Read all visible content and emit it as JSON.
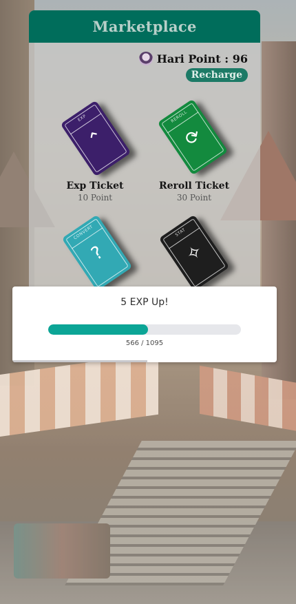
{
  "marketplace": {
    "title": "Marketplace",
    "points_label": "Hari Point : 96",
    "recharge_label": "Recharge",
    "tickets": [
      {
        "name": "Exp Ticket",
        "price": "10 Point",
        "tag": "EXP",
        "icon": "double-chevron-up-icon",
        "color": "#3c1f6a"
      },
      {
        "name": "Reroll Ticket",
        "price": "30 Point",
        "tag": "REROLL",
        "icon": "refresh-arrows-icon",
        "color": "#138a3e"
      },
      {
        "name": "",
        "price": "",
        "tag": "CONVERT",
        "icon": "cards-question-icon",
        "color": "#32a9b4"
      },
      {
        "name": "",
        "price": "",
        "tag": "STAT",
        "icon": "elements-icon",
        "color": "#1e1e1e"
      }
    ]
  },
  "exp_popup": {
    "title": "5 EXP Up!",
    "current": 566,
    "max": 1095,
    "count_label": "566 / 1095",
    "progress_fraction": 0.517,
    "dismiss_timer_fraction": 0.51
  }
}
